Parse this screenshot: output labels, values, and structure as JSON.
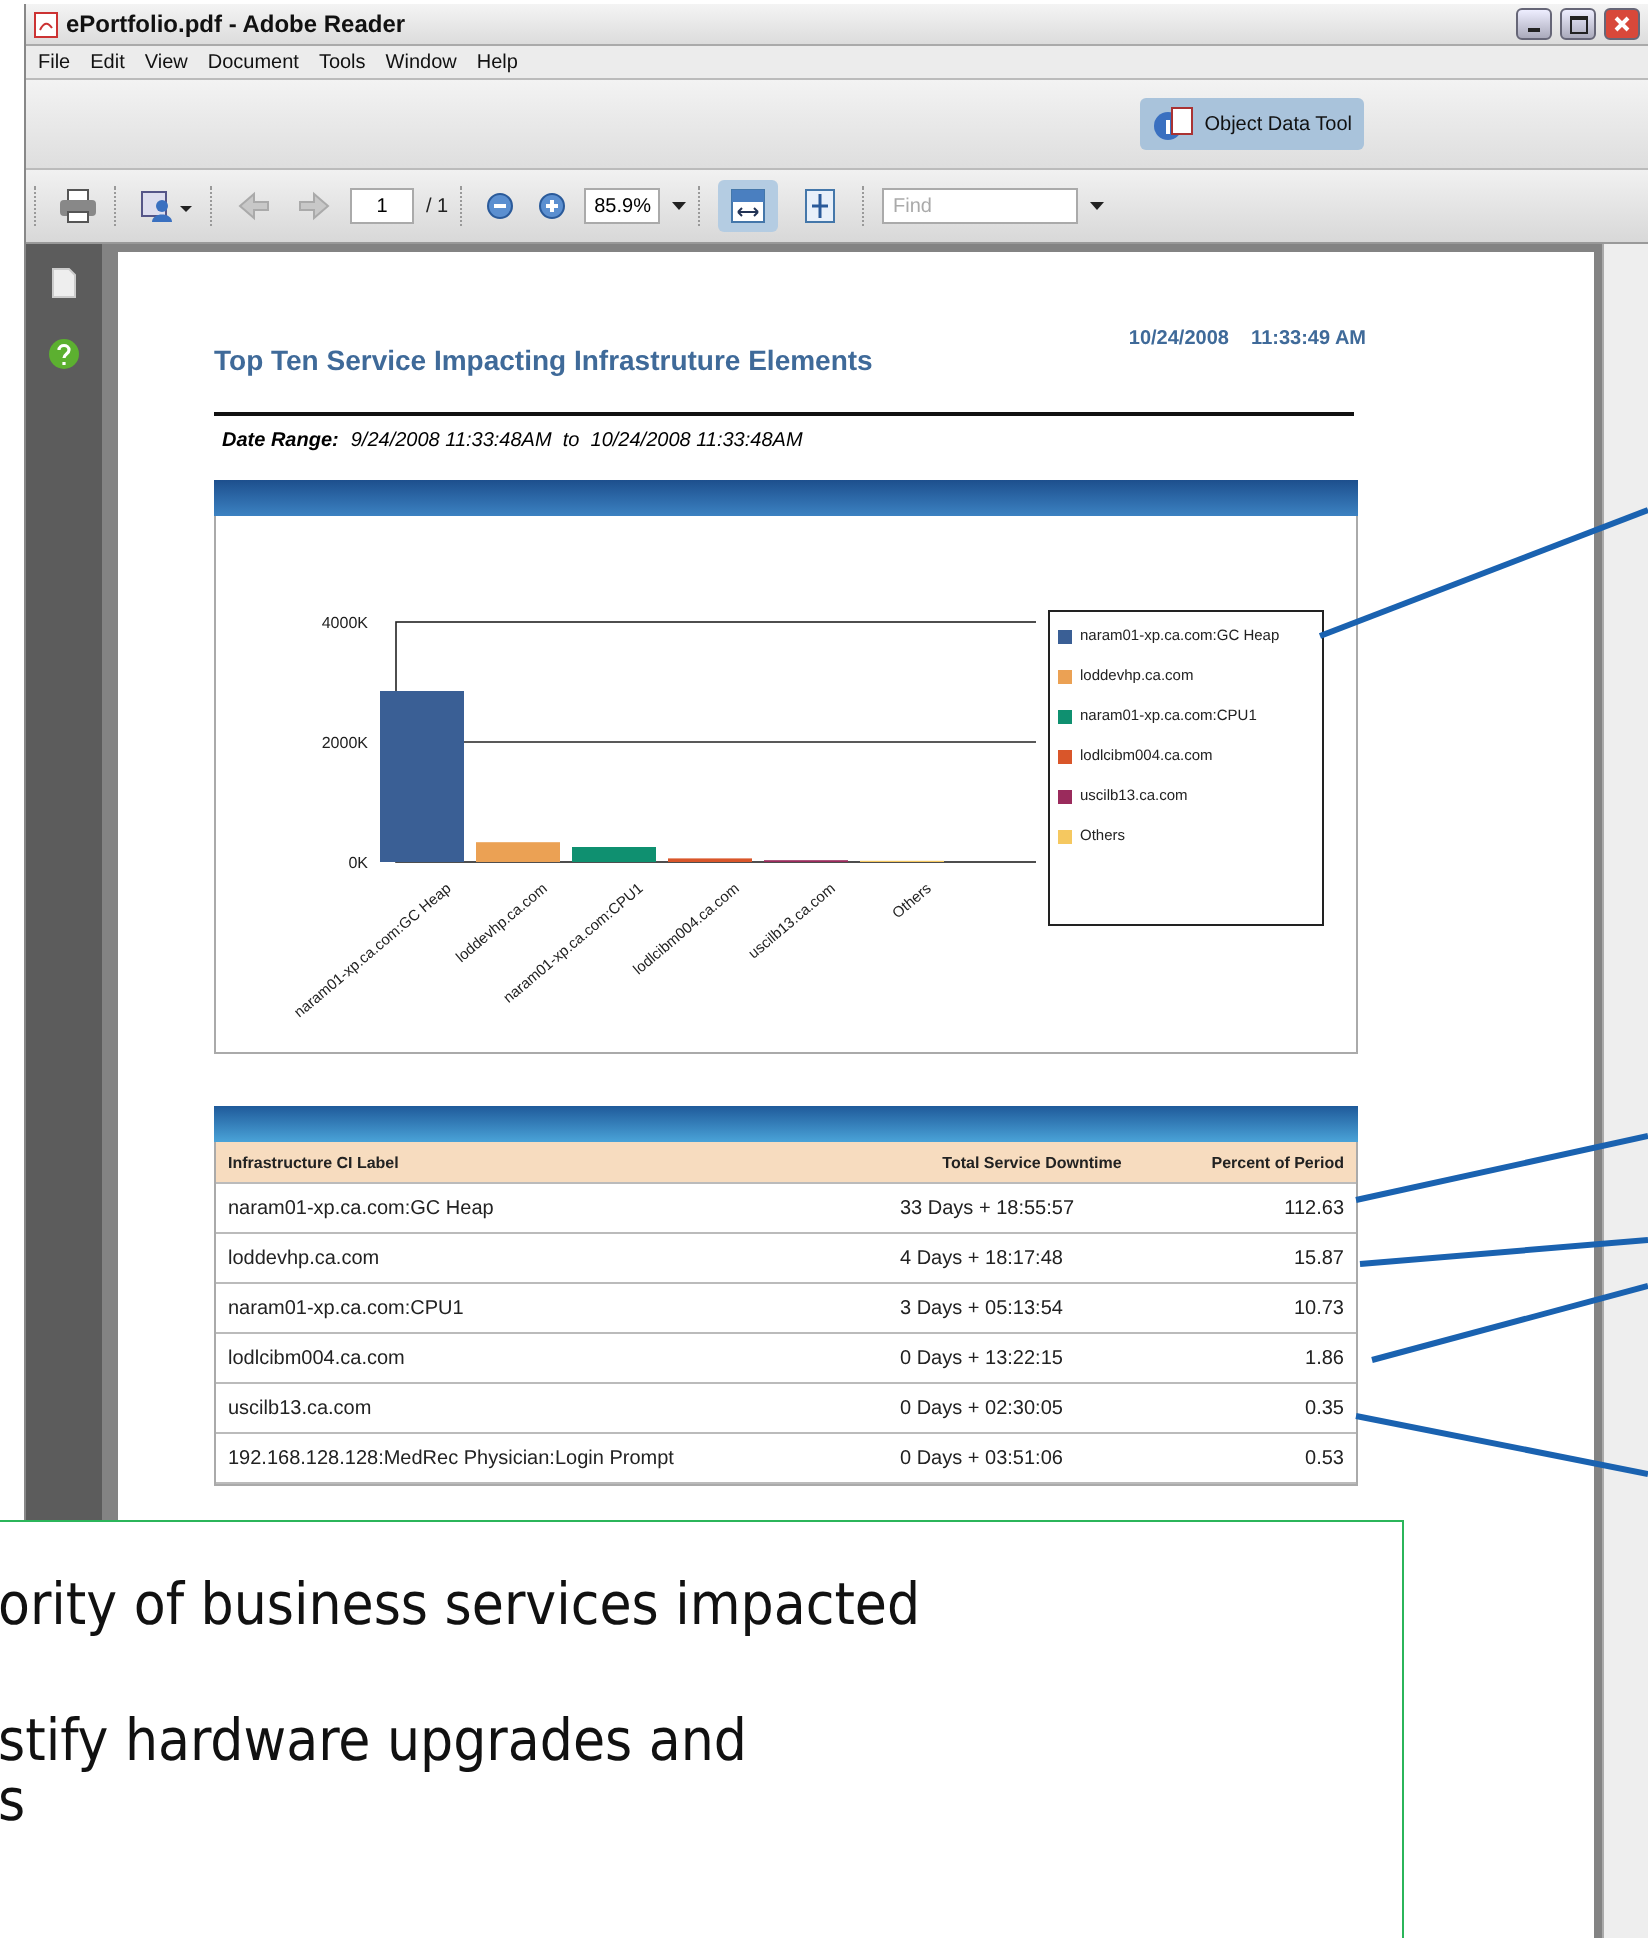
{
  "window": {
    "title": "ePortfolio.pdf - Adobe Reader"
  },
  "menu": [
    "File",
    "Edit",
    "View",
    "Document",
    "Tools",
    "Window",
    "Help"
  ],
  "tools_toolbar": {
    "object_data_tool": {
      "label": "Object Data Tool",
      "selected": true
    }
  },
  "nav_toolbar": {
    "page": "1",
    "page_count": "/ 1",
    "zoom": "85.9%",
    "view_modes": [
      {
        "kind": "fit-width",
        "selected": true
      },
      {
        "kind": "fit-page",
        "selected": false
      }
    ],
    "find": {
      "placeholder": "Find"
    }
  },
  "report": {
    "title": "Top Ten Service Impacting Infrastruture Elements",
    "date": "10/24/2008",
    "time": "11:33:49 AM",
    "date_range_label": "Date Range:",
    "date_range": "9/24/2008 11:33:48AM  to  10/24/2008 11:33:48AM",
    "chart_data": {
      "type": "bar",
      "categories": [
        "naram01-xp.ca.com:GC Heap",
        "loddevhp.ca.com",
        "naram01-xp.ca.com:CPU1",
        "lodlcibm004.ca.com",
        "uscilb13.ca.com",
        "Others"
      ],
      "values": [
        2850,
        330,
        250,
        60,
        30,
        20
      ],
      "ylim": [
        0,
        4000
      ],
      "yticks": [
        {
          "value": 0,
          "label": "0K"
        },
        {
          "value": 2000,
          "label": "2000K"
        },
        {
          "value": 4000,
          "label": "4000K"
        }
      ]
    },
    "legend": [
      {
        "label": "naram01-xp.ca.com:GC Heap",
        "color": "#3a5f95"
      },
      {
        "label": "loddevhp.ca.com",
        "color": "#eba154"
      },
      {
        "label": "naram01-xp.ca.com:CPU1",
        "color": "#0f9070"
      },
      {
        "label": "lodlcibm004.ca.com",
        "color": "#d9562a"
      },
      {
        "label": "uscilb13.ca.com",
        "color": "#9a2b5c"
      },
      {
        "label": "Others",
        "color": "#f5c860"
      }
    ],
    "table": {
      "columns": [
        "Infrastructure CI Label",
        "Total Service Downtime",
        "Percent of Period"
      ],
      "rows": [
        [
          "naram01-xp.ca.com:GC Heap",
          "33 Days + 18:55:57",
          "112.63"
        ],
        [
          "loddevhp.ca.com",
          "4 Days + 18:17:48",
          "15.87"
        ],
        [
          "naram01-xp.ca.com:CPU1",
          "3 Days + 05:13:54",
          "10.73"
        ],
        [
          "lodlcibm004.ca.com",
          "0 Days + 13:22:15",
          "1.86"
        ],
        [
          "uscilb13.ca.com",
          "0 Days + 02:30:05",
          "0.35"
        ],
        [
          "192.168.128.128:MedRec Physician:Login Prompt",
          "0 Days + 03:51:06",
          "0.53"
        ]
      ]
    }
  },
  "callout": {
    "lines": [
      "ority of business services impacted",
      "stify hardware upgrades and",
      "s"
    ]
  }
}
